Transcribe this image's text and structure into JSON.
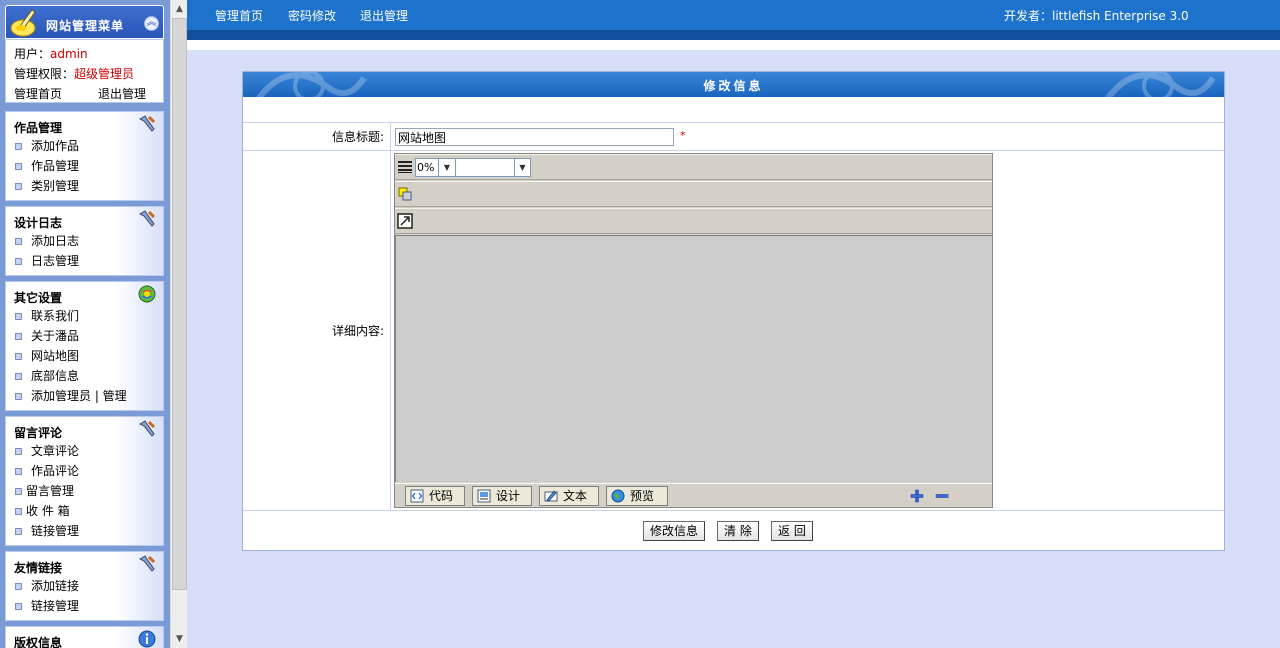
{
  "menu": {
    "title": "网站管理菜单",
    "collapse_icon": "double-chevron-up",
    "user_label": "用户：",
    "user_name": "admin",
    "perm_label": "管理权限：",
    "perm_value": "超级管理员",
    "home_link": "管理首页",
    "logout_link": "退出管理"
  },
  "sections": [
    {
      "title": "作品管理",
      "icon": "tools-icon",
      "items": [
        "添加作品",
        "作品管理",
        "类别管理"
      ]
    },
    {
      "title": "设计日志",
      "icon": "tools-icon",
      "items": [
        "添加日志",
        "日志管理"
      ]
    },
    {
      "title": "其它设置",
      "icon": "globe-color-icon",
      "items": [
        "联系我们",
        "关于潘品",
        "网站地图",
        "底部信息",
        "添加管理员 | 管理"
      ]
    },
    {
      "title": "留言评论",
      "icon": "tools-icon",
      "items": [
        "文章评论",
        "作品评论",
        "留言管理",
        "收 件 箱",
        "链接管理"
      ]
    },
    {
      "title": "友情链接",
      "icon": "tools-icon",
      "items": [
        "添加链接",
        "链接管理"
      ]
    },
    {
      "title": "版权信息",
      "icon": "info-icon",
      "items": []
    }
  ],
  "topnav": {
    "home": "管理首页",
    "password": "密码修改",
    "logout": "退出管理",
    "developer": "开发者：littlefish Enterprise 3.0"
  },
  "form": {
    "header": "修改信息",
    "title_label": "信息标题:",
    "title_value": "网站地图",
    "required_mark": "*",
    "detail_label": "详细内容:",
    "zoom_value": "0%",
    "modes": [
      "代码",
      "设计",
      "文本",
      "预览"
    ],
    "submit": "修改信息",
    "clear": "清 除",
    "back": "返 回"
  },
  "colors": {
    "topbar": "#1d72cc",
    "accent_red": "#cc0000",
    "page_bg": "#d6dff7"
  }
}
